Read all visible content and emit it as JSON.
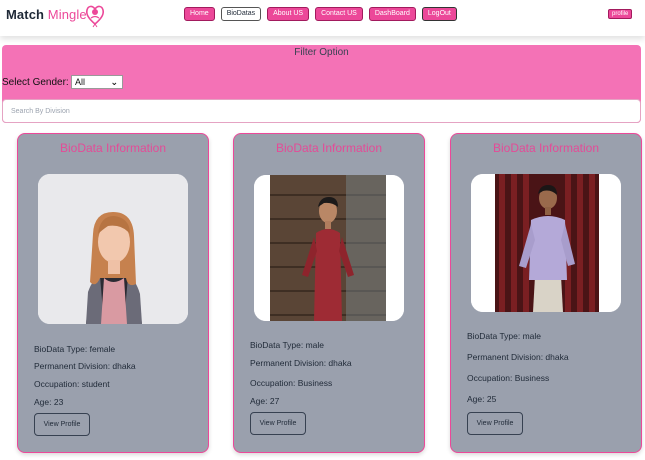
{
  "brand": {
    "part1": "Match",
    "part2": "Mingle"
  },
  "nav": {
    "links": [
      "Home",
      "BioDatas",
      "About US",
      "Contact US",
      "DashBoard",
      "LogOut"
    ],
    "active": "BioDatas",
    "profile": "profile"
  },
  "filter": {
    "title": "Filter Option",
    "gender_label": "Select Gender:",
    "gender_value": "All",
    "search_placeholder": "Search By Division"
  },
  "cards": [
    {
      "title": "BioData Information",
      "type": "BioData Type: female",
      "division": "Permanent Division: dhaka",
      "occupation": "Occupation: student",
      "age": "Age: 23",
      "button": "View Profile"
    },
    {
      "title": "BioData Information",
      "type": "BioData Type: male",
      "division": "Permanent Division: dhaka",
      "occupation": "Occupation: Business",
      "age": "Age: 27",
      "button": "View Profile"
    },
    {
      "title": "BioData Information",
      "type": "BioData Type: male",
      "division": "Permanent Division: dhaka",
      "occupation": "Occupation: Business",
      "age": "Age: 25",
      "button": "View Profile"
    }
  ],
  "colors": {
    "accent": "#ec4899",
    "filter_bg": "#f472b6",
    "card_bg": "#9aa0ad"
  }
}
